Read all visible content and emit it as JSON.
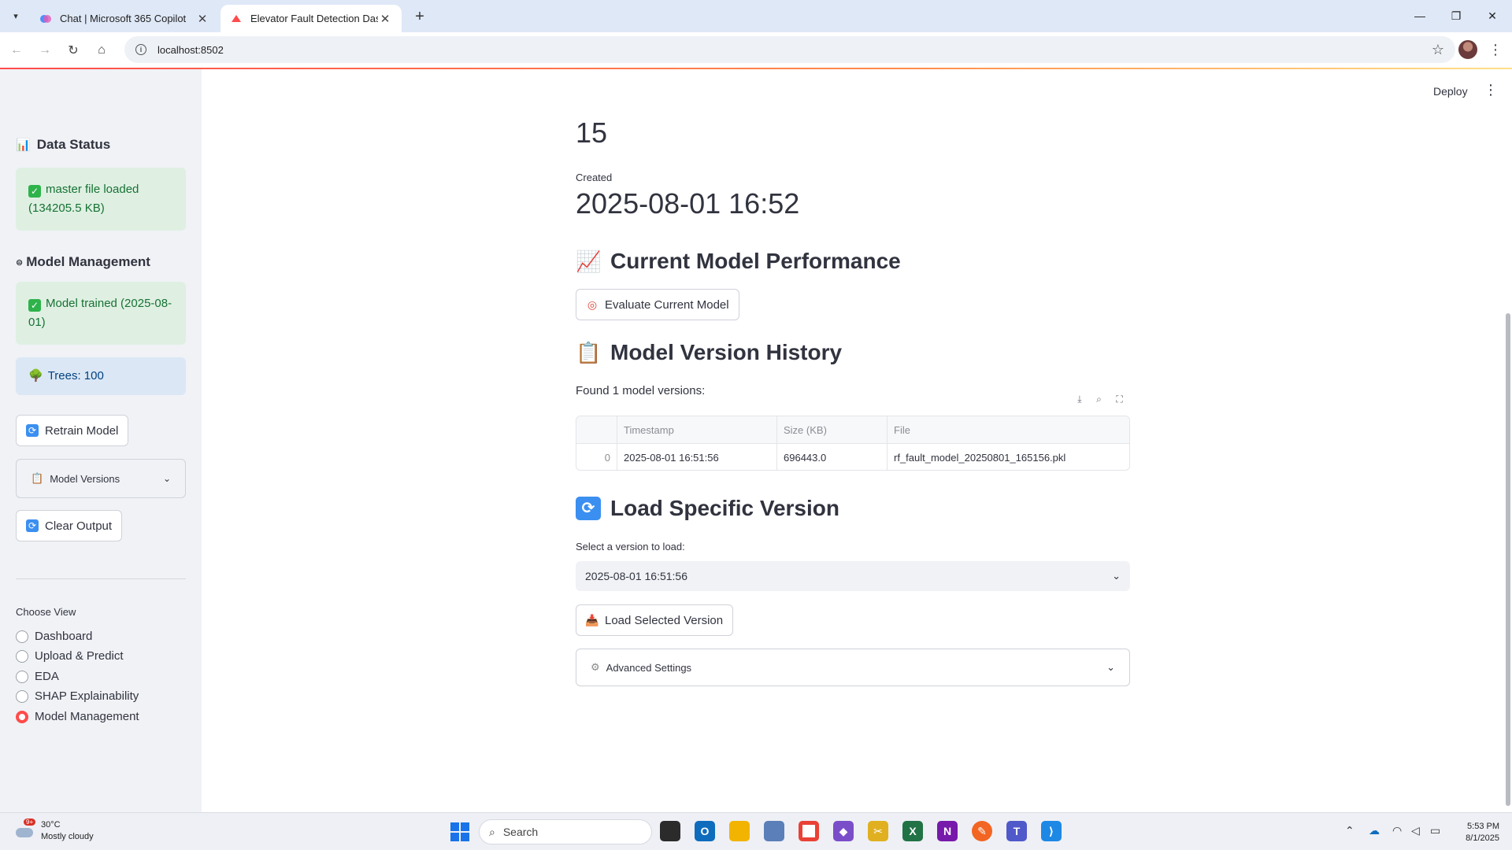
{
  "browser": {
    "tabs": [
      {
        "title": "Chat | Microsoft 365 Copilot",
        "active": false
      },
      {
        "title": "Elevator Fault Detection Dashbo",
        "active": true
      }
    ],
    "url": "localhost:8502"
  },
  "app": {
    "deploy_label": "Deploy",
    "sidebar": {
      "data_status": {
        "heading": "Data Status",
        "alert": "master file loaded (134205.5 KB)"
      },
      "model_management": {
        "heading": "Model Management",
        "trained_alert": "Model trained (2025-08-01)",
        "trees_info": "Trees: 100",
        "retrain_button": "Retrain Model",
        "versions_expander": "Model Versions",
        "clear_button": "Clear Output"
      },
      "choose_view": {
        "label": "Choose View",
        "options": [
          "Dashboard",
          "Upload & Predict",
          "EDA",
          "SHAP Explainability",
          "Model Management"
        ],
        "selected": "Model Management"
      }
    },
    "main": {
      "metric_value": "15",
      "created_label": "Created",
      "created_value": "2025-08-01 16:52",
      "performance": {
        "heading": "Current Model Performance",
        "evaluate_button": "Evaluate Current Model"
      },
      "history": {
        "heading": "Model Version History",
        "found_text": "Found 1 model versions:",
        "columns": [
          "",
          "Timestamp",
          "Size (KB)",
          "File"
        ],
        "rows": [
          [
            "0",
            "2025-08-01 16:51:56",
            "696443.0",
            "rf_fault_model_20250801_165156.pkl"
          ]
        ]
      },
      "load": {
        "heading": "Load Specific Version",
        "select_label": "Select a version to load:",
        "select_value": "2025-08-01 16:51:56",
        "load_button": "Load Selected Version",
        "advanced_expander": "Advanced Settings"
      }
    }
  },
  "taskbar": {
    "weather_temp": "30°C",
    "weather_desc": "Mostly cloudy",
    "weather_badge": "9+",
    "search_placeholder": "Search",
    "time": "5:53 PM",
    "date": "8/1/2025"
  },
  "colors": {
    "accent": "#ff4b4b",
    "sidebar_bg": "#f0f2f6",
    "success_bg": "#dff0e3",
    "success_text": "#177233",
    "info_bg": "#dbe7f5",
    "info_text": "#004280"
  }
}
